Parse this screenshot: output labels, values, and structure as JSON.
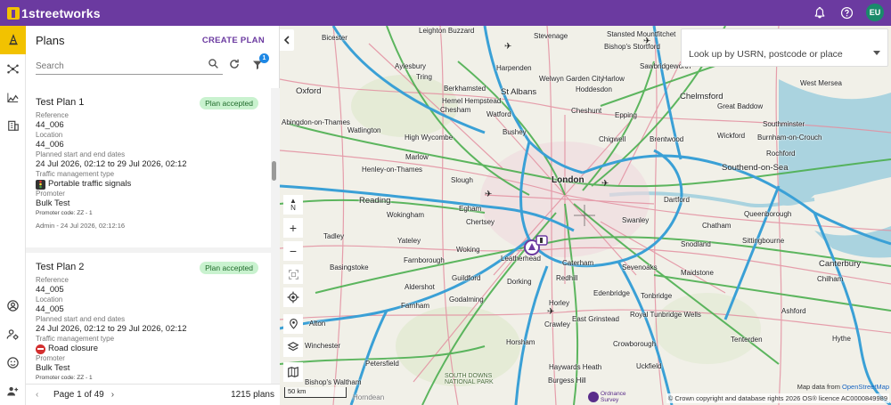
{
  "app": {
    "brand": "1streetworks",
    "user_initials": "EU"
  },
  "colors": {
    "header": "#6b3aa0",
    "accent_yellow": "#f2c200",
    "badge_green_bg": "#c9f2cf",
    "avatar": "#1a8a6b"
  },
  "icons": {
    "top": [
      "bell-icon",
      "help-icon"
    ],
    "rail": [
      "cone-icon",
      "network-icon",
      "analytics-icon",
      "building-icon"
    ],
    "rail_bottom": [
      "account-icon",
      "admin-settings-icon",
      "support-icon",
      "user-settings-icon"
    ]
  },
  "panel": {
    "title": "Plans",
    "create_label": "CREATE PLAN",
    "search_placeholder": "Search",
    "filter_count": "1"
  },
  "plans": [
    {
      "title": "Test Plan 1",
      "status": "Plan accepted",
      "reference_label": "Reference",
      "reference": "44_006",
      "location_label": "Location",
      "location": "44_006",
      "dates_label": "Planned start and end dates",
      "dates": "24 Jul 2026, 02:12 to 29 Jul 2026, 02:12",
      "tm_label": "Traffic management type",
      "tm_type": "Portable traffic signals",
      "promoter_label": "Promoter",
      "promoter": "Bulk Test",
      "promoter_code": "Promoter code: ZZ - 1",
      "admin": "Admin - 24 Jul 2026, 02:12:16"
    },
    {
      "title": "Test Plan 2",
      "status": "Plan accepted",
      "reference_label": "Reference",
      "reference": "44_005",
      "location_label": "Location",
      "location": "44_005",
      "dates_label": "Planned start and end dates",
      "dates": "24 Jul 2026, 02:12 to 29 Jul 2026, 02:12",
      "tm_label": "Traffic management type",
      "tm_type": "Road closure",
      "promoter_label": "Promoter",
      "promoter": "Bulk Test",
      "promoter_code": "Promoter code: ZZ - 1"
    }
  ],
  "footer": {
    "page_text": "Page 1 of 49",
    "total": "1215 plans"
  },
  "map": {
    "lookup_placeholder": "Look up by USRN, postcode or place",
    "north_label": "N",
    "scale_label": "50 km",
    "map_data_prefix": "Map data from",
    "map_data_link": "OpenStreetMap",
    "attribution": "© Crown copyright and database rights 2026 OS® licence AC0000849989",
    "os_logo_text": "Ordnance Survey",
    "places": [
      {
        "name": "Bicester"
      },
      {
        "name": "Leighton Buzzard"
      },
      {
        "name": "Stevenage"
      },
      {
        "name": "Stansted Mountfitchet"
      },
      {
        "name": "Bishop's Stortford"
      },
      {
        "name": "Aylesbury"
      },
      {
        "name": "Tring"
      },
      {
        "name": "Harpenden"
      },
      {
        "name": "Sawbridgeworth"
      },
      {
        "name": "Harlow"
      },
      {
        "name": "Welwyn Garden City"
      },
      {
        "name": "Berkhamsted"
      },
      {
        "name": "Hemel Hempstead"
      },
      {
        "name": "St Albans"
      },
      {
        "name": "Hoddesdon"
      },
      {
        "name": "Chelmsford"
      },
      {
        "name": "Great Baddow"
      },
      {
        "name": "West Mersea"
      },
      {
        "name": "Oxford"
      },
      {
        "name": "Chesham"
      },
      {
        "name": "Watford"
      },
      {
        "name": "Cheshunt"
      },
      {
        "name": "Epping"
      },
      {
        "name": "Abingdon-on-Thames"
      },
      {
        "name": "Watlington"
      },
      {
        "name": "High Wycombe"
      },
      {
        "name": "Bushey"
      },
      {
        "name": "Chigwell"
      },
      {
        "name": "Brentwood"
      },
      {
        "name": "Wickford"
      },
      {
        "name": "Southminster"
      },
      {
        "name": "Burnham-on-Crouch"
      },
      {
        "name": "Henley-on-Thames"
      },
      {
        "name": "Marlow"
      },
      {
        "name": "Slough"
      },
      {
        "name": "London"
      },
      {
        "name": "Rochford"
      },
      {
        "name": "Southend-on-Sea"
      },
      {
        "name": "Reading"
      },
      {
        "name": "Wokingham"
      },
      {
        "name": "Egham"
      },
      {
        "name": "Chertsey"
      },
      {
        "name": "Dartford"
      },
      {
        "name": "Swanley"
      },
      {
        "name": "Queenborough"
      },
      {
        "name": "Tadley"
      },
      {
        "name": "Yateley"
      },
      {
        "name": "Woking"
      },
      {
        "name": "Chatham"
      },
      {
        "name": "Sittingbourne"
      },
      {
        "name": "Leatherhead"
      },
      {
        "name": "Basingstoke"
      },
      {
        "name": "Farnborough"
      },
      {
        "name": "Caterham"
      },
      {
        "name": "Sevenoaks"
      },
      {
        "name": "Snodland"
      },
      {
        "name": "Canterbury"
      },
      {
        "name": "Aldershot"
      },
      {
        "name": "Guildford"
      },
      {
        "name": "Dorking"
      },
      {
        "name": "Redhill"
      },
      {
        "name": "Tonbridge"
      },
      {
        "name": "Maidstone"
      },
      {
        "name": "Chilham"
      },
      {
        "name": "Farnham"
      },
      {
        "name": "Godalming"
      },
      {
        "name": "Edenbridge"
      },
      {
        "name": "Ashford"
      },
      {
        "name": "Alton"
      },
      {
        "name": "Horley"
      },
      {
        "name": "East Grinstead"
      },
      {
        "name": "Royal Tunbridge Wells"
      },
      {
        "name": "Crawley"
      },
      {
        "name": "Crowborough"
      },
      {
        "name": "Tenterden"
      },
      {
        "name": "Hythe"
      },
      {
        "name": "Horsham"
      },
      {
        "name": "Petersfield"
      },
      {
        "name": "Haywards Heath"
      },
      {
        "name": "Uckfield"
      },
      {
        "name": "Burgess Hill"
      },
      {
        "name": "Winchester"
      },
      {
        "name": "Bishop's Waltham"
      },
      {
        "name": "SOUTH DOWNS NATIONAL PARK"
      },
      {
        "name": "Horndean"
      }
    ]
  }
}
